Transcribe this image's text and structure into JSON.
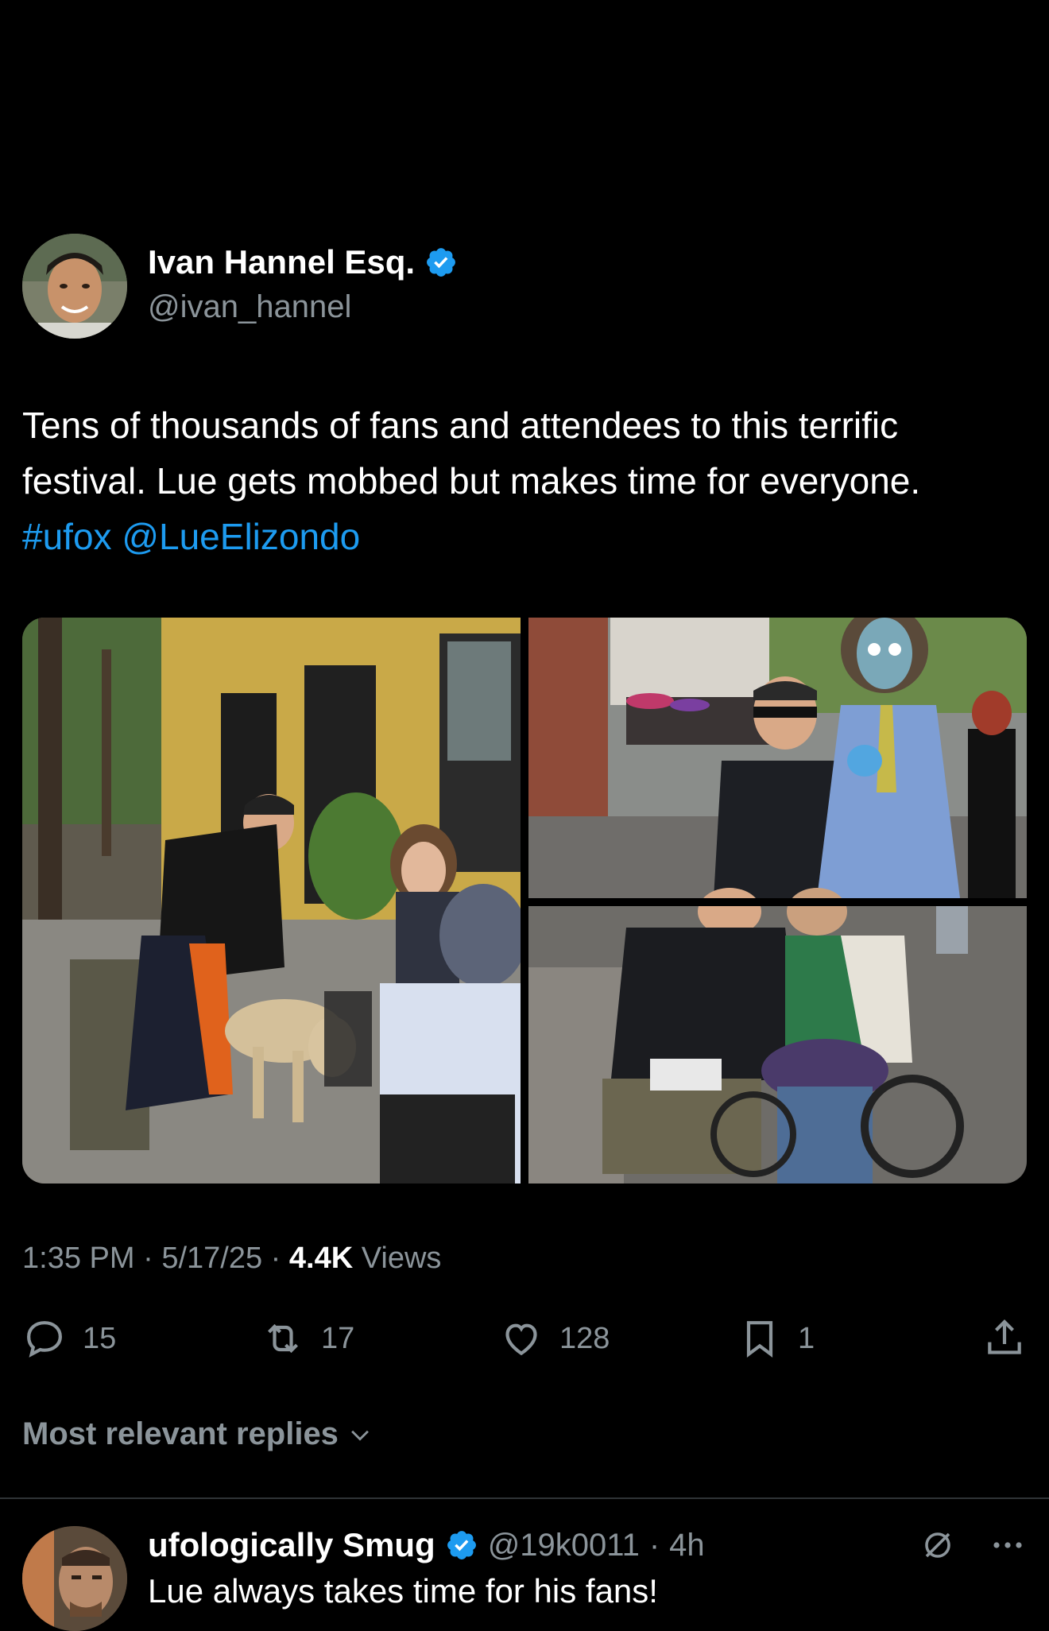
{
  "tweet": {
    "author": {
      "display_name": "Ivan Hannel Esq.",
      "handle": "@ivan_hannel",
      "verified": true
    },
    "text": {
      "body": "Tens of thousands of fans and attendees to this terrific festival. Lue gets mobbed but makes time for everyone.",
      "hashtag": "#ufox",
      "mention": "@LueElizondo"
    },
    "time": "1:35 PM",
    "date": "5/17/25",
    "views_count": "4.4K",
    "views_label": "Views",
    "stats": {
      "replies": "15",
      "reposts": "17",
      "likes": "128",
      "bookmarks": "1"
    }
  },
  "replies_section": {
    "header": "Most relevant replies"
  },
  "reply": {
    "display_name": "ufologically Smug",
    "handle": "@19k0011",
    "age": "4h",
    "text": "Lue always takes time for his fans!"
  },
  "colors": {
    "background": "#000000",
    "accent": "#1d9bf0",
    "muted": "#8b949a"
  }
}
